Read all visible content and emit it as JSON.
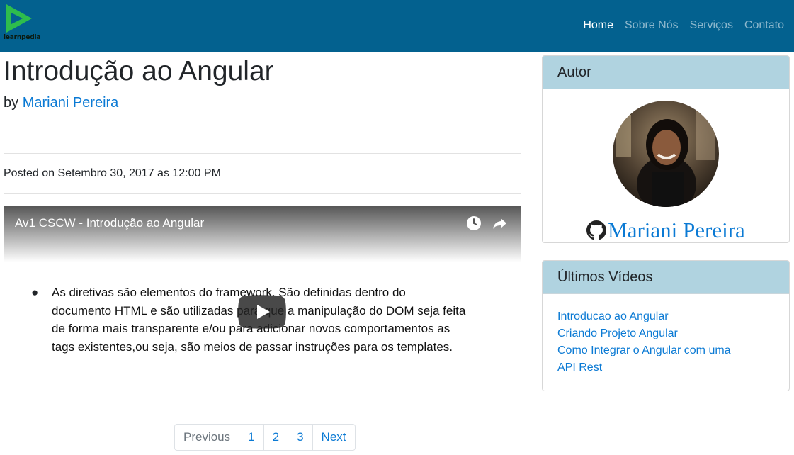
{
  "brand": {
    "logo_text": "learnpedia",
    "colors": {
      "navbar": "#03618f",
      "link": "#0b7ad4",
      "card_header": "#b0d3e0"
    }
  },
  "nav": {
    "items": [
      {
        "label": "Home",
        "active": true
      },
      {
        "label": "Sobre Nós",
        "active": false
      },
      {
        "label": "Serviços",
        "active": false
      },
      {
        "label": "Contato",
        "active": false
      }
    ]
  },
  "post": {
    "title": "Introdução ao Angular",
    "by_prefix": "by",
    "author": "Mariani Pereira",
    "posted": "Posted on Setembro 30, 2017 as 12:00 PM"
  },
  "video": {
    "title": "Av1 CSCW - Introdução ao Angular",
    "icons": [
      "clock-icon",
      "share-icon",
      "play-icon"
    ],
    "slide_lines": [
      "As diretivas são elementos do framework. São definidas dentro do",
      "documento HTML e são utilizadas para que a manipulação do DOM seja feita",
      "de forma mais transparente e/ou para adicionar novos comportamentos as",
      "tags existentes,ou seja, são meios de passar instruções para os templates."
    ]
  },
  "pagination": {
    "items": [
      "Previous",
      "1",
      "2",
      "3",
      "Next"
    ]
  },
  "sidebar": {
    "author_card": {
      "header": "Autor",
      "name": "Mariani Pereira",
      "icon": "github-icon"
    },
    "videos_card": {
      "header": "Últimos Vídeos",
      "items": [
        "Introducao ao Angular",
        "Criando Projeto Angular",
        "Como Integrar o Angular com uma",
        "API Rest"
      ]
    }
  }
}
